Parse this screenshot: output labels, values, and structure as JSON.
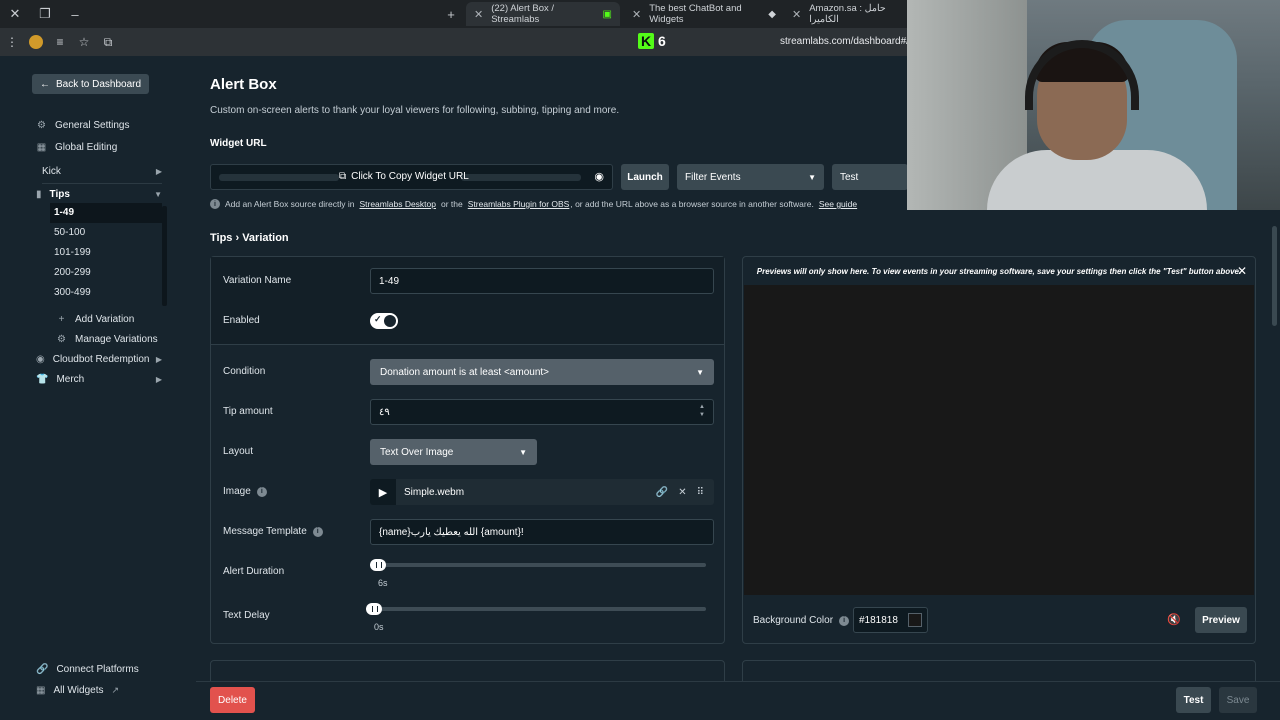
{
  "browser": {
    "tabs": [
      {
        "title": "(22) Alert Box / Streamlabs"
      },
      {
        "title": "The best ChatBot and Widgets"
      },
      {
        "title": "Amazon.sa : حامل الكاميرا"
      }
    ],
    "url": "streamlabs.com/dashboard#/a",
    "kick_count": "6"
  },
  "sidebar": {
    "back_label": "Back to Dashboard",
    "general_settings": "General Settings",
    "global_editing": "Global Editing",
    "kick": "Kick",
    "tips": "Tips",
    "variations": [
      "1-49",
      "50-100",
      "101-199",
      "200-299",
      "300-499"
    ],
    "add_variation": "Add Variation",
    "manage_variations": "Manage Variations",
    "cloudbot": "Cloudbot Redemption",
    "merch": "Merch",
    "connect_platforms": "Connect Platforms",
    "all_widgets": "All Widgets"
  },
  "main": {
    "title": "Alert Box",
    "description": "Custom on-screen alerts to thank your loyal viewers for following, subbing, tipping and more.",
    "widget_url_label": "Widget URL",
    "copy_label": "Click To Copy Widget URL",
    "launch": "Launch",
    "filter_events": "Filter Events",
    "test": "Test",
    "help": {
      "prefix": "Add an Alert Box source directly in",
      "link1": "Streamlabs Desktop",
      "mid": "or the",
      "link2": "Streamlabs Plugin for OBS",
      "suffix": ", or add the URL above as a browser source in another software.",
      "link3": "See guide"
    },
    "breadcrumb": "Tips › Variation"
  },
  "form": {
    "variation_name_label": "Variation Name",
    "variation_name_value": "1-49",
    "enabled_label": "Enabled",
    "enabled": true,
    "condition_label": "Condition",
    "condition_value": "Donation amount is at least <amount>",
    "tip_amount_label": "Tip amount",
    "tip_amount_value": "٤٩",
    "layout_label": "Layout",
    "layout_value": "Text Over Image",
    "image_label": "Image",
    "image_file": "Simple.webm",
    "message_label": "Message Template",
    "message_value": "{name}الله يعطيك يارب {amount}!",
    "alert_duration_label": "Alert Duration",
    "alert_duration_value": "6s",
    "alert_duration_fraction": 0.0,
    "text_delay_label": "Text Delay",
    "text_delay_value": "0s",
    "text_delay_fraction": 0.0
  },
  "preview": {
    "note": "Previews will only show here. To view events in your streaming software, save your settings then click the \"Test\" button above.",
    "bg_label": "Background Color",
    "bg_value": "#181818",
    "preview_btn": "Preview"
  },
  "footer": {
    "delete": "Delete",
    "test": "Test",
    "save": "Save"
  },
  "colors": {
    "background": "#17242d",
    "delete": "#e2524d",
    "kick_green": "#53fc18"
  }
}
